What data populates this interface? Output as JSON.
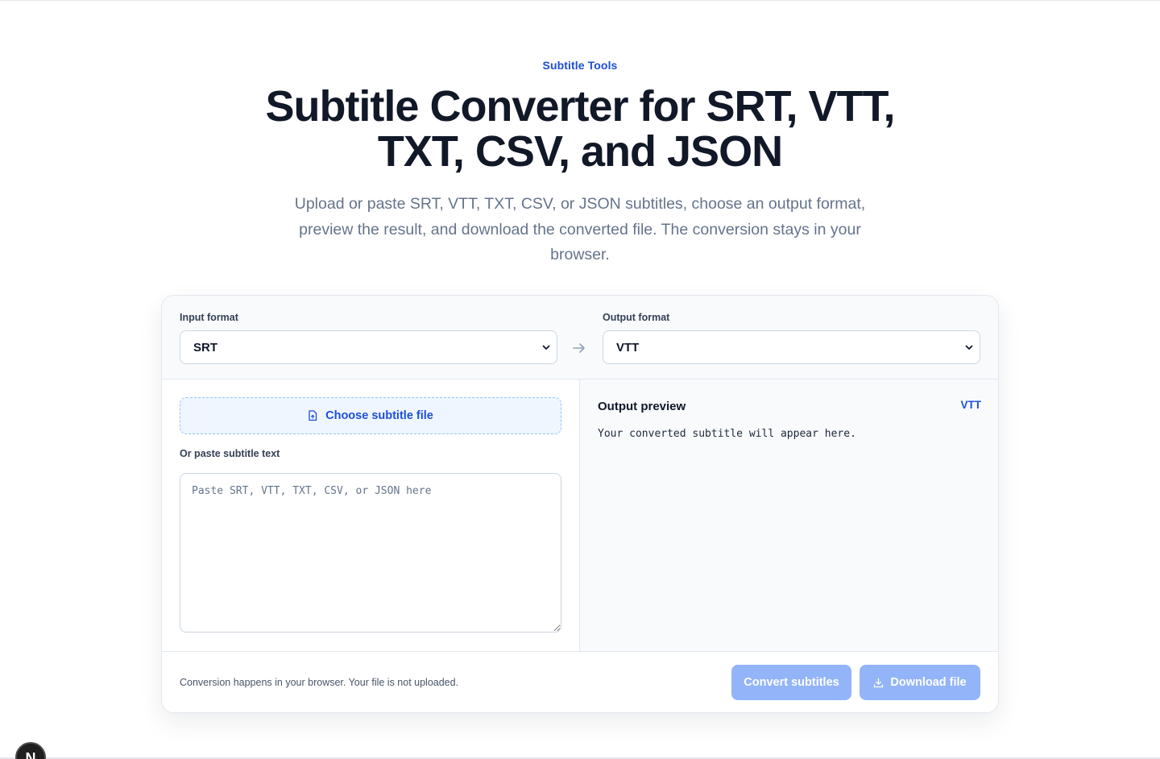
{
  "hero": {
    "eyebrow": "Subtitle Tools",
    "title": "Subtitle Converter for SRT, VTT, TXT, CSV, and JSON",
    "subtitle": "Upload or paste SRT, VTT, TXT, CSV, or JSON subtitles, choose an output format, preview the result, and download the converted file. The conversion stays in your browser."
  },
  "converter": {
    "input_format_label": "Input format",
    "input_format_value": "SRT",
    "output_format_label": "Output format",
    "output_format_value": "VTT",
    "upload_label": "Choose subtitle file",
    "paste_label": "Or paste subtitle text",
    "paste_placeholder": "Paste SRT, VTT, TXT, CSV, or JSON here",
    "preview_title": "Output preview",
    "preview_badge": "VTT",
    "preview_placeholder": "Your converted subtitle will appear here.",
    "footer_note": "Conversion happens in your browser. Your file is not uploaded.",
    "convert_label": "Convert subtitles",
    "download_label": "Download file"
  },
  "dev_badge": {
    "letter": "N"
  },
  "colors": {
    "accent": "#1d4ed8",
    "button_disabled": "#93b4f8",
    "heading": "#111827",
    "muted": "#64748b"
  },
  "icons": [
    "chevron-down-icon",
    "arrow-right-icon",
    "file-upload-icon",
    "download-icon",
    "nextjs-icon"
  ]
}
